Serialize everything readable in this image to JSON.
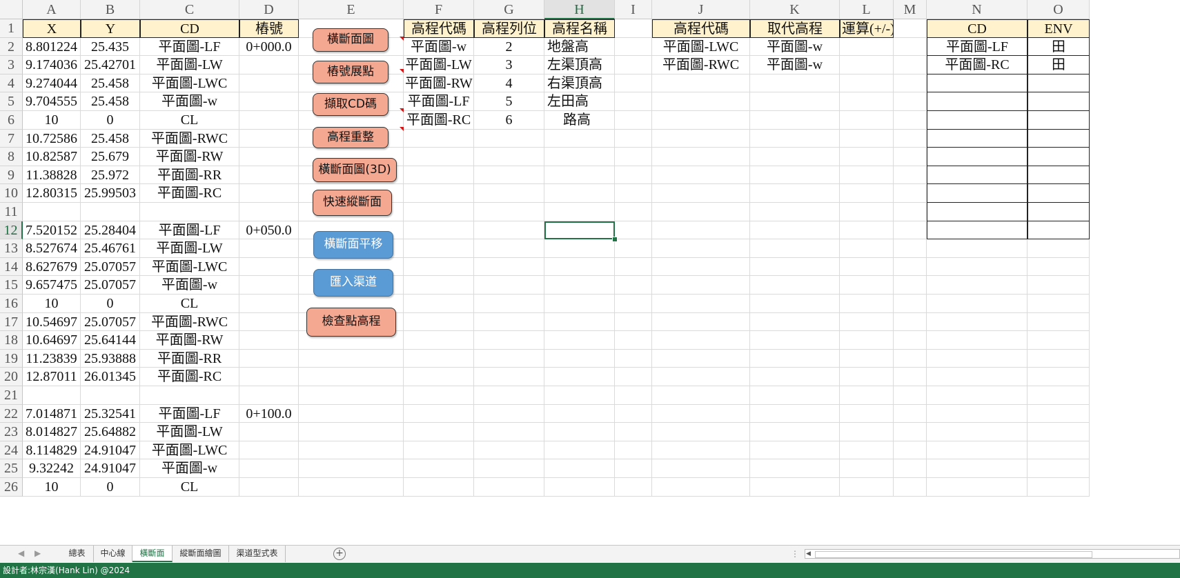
{
  "columns": [
    "A",
    "B",
    "C",
    "D",
    "E",
    "F",
    "G",
    "H",
    "I",
    "J",
    "K",
    "L",
    "M",
    "N",
    "O"
  ],
  "active_column": "H",
  "active_row": 12,
  "rows": [
    {
      "num": 1,
      "A": "X",
      "B": "Y",
      "C": "CD",
      "D": "樁號",
      "F": "高程代碼",
      "G": "高程列位",
      "H": "高程名稱",
      "J": "高程代碼",
      "K": "取代高程",
      "L": "運算(+/-)",
      "N": "CD",
      "O": "ENV"
    },
    {
      "num": 2,
      "A": "8.801224",
      "B": "25.435",
      "C": "平面圖-LF",
      "D": "0+000.0",
      "F": "平面圖-w",
      "G": "2",
      "H": "地盤高",
      "J": "平面圖-LWC",
      "K": "平面圖-w",
      "N": "平面圖-LF",
      "O": "田"
    },
    {
      "num": 3,
      "A": "9.174036",
      "B": "25.42701",
      "C": "平面圖-LW",
      "F": "平面圖-LW",
      "G": "3",
      "H": "左渠頂高",
      "J": "平面圖-RWC",
      "K": "平面圖-w",
      "N": "平面圖-RC",
      "O": "田"
    },
    {
      "num": 4,
      "A": "9.274044",
      "B": "25.458",
      "C": "平面圖-LWC",
      "F": "平面圖-RW",
      "G": "4",
      "H": "右渠頂高"
    },
    {
      "num": 5,
      "A": "9.704555",
      "B": "25.458",
      "C": "平面圖-w",
      "F": "平面圖-LF",
      "G": "5",
      "H": "左田高"
    },
    {
      "num": 6,
      "A": "10",
      "B": "0",
      "C": "CL",
      "F": "平面圖-RC",
      "G": "6",
      "H": "路高"
    },
    {
      "num": 7,
      "A": "10.72586",
      "B": "25.458",
      "C": "平面圖-RWC"
    },
    {
      "num": 8,
      "A": "10.82587",
      "B": "25.679",
      "C": "平面圖-RW"
    },
    {
      "num": 9,
      "A": "11.38828",
      "B": "25.972",
      "C": "平面圖-RR"
    },
    {
      "num": 10,
      "A": "12.80315",
      "B": "25.99503",
      "C": "平面圖-RC"
    },
    {
      "num": 11
    },
    {
      "num": 12,
      "A": "7.520152",
      "B": "25.28404",
      "C": "平面圖-LF",
      "D": "0+050.0"
    },
    {
      "num": 13,
      "A": "8.527674",
      "B": "25.46761",
      "C": "平面圖-LW"
    },
    {
      "num": 14,
      "A": "8.627679",
      "B": "25.07057",
      "C": "平面圖-LWC"
    },
    {
      "num": 15,
      "A": "9.657475",
      "B": "25.07057",
      "C": "平面圖-w"
    },
    {
      "num": 16,
      "A": "10",
      "B": "0",
      "C": "CL"
    },
    {
      "num": 17,
      "A": "10.54697",
      "B": "25.07057",
      "C": "平面圖-RWC"
    },
    {
      "num": 18,
      "A": "10.64697",
      "B": "25.64144",
      "C": "平面圖-RW"
    },
    {
      "num": 19,
      "A": "11.23839",
      "B": "25.93888",
      "C": "平面圖-RR"
    },
    {
      "num": 20,
      "A": "12.87011",
      "B": "26.01345",
      "C": "平面圖-RC"
    },
    {
      "num": 21
    },
    {
      "num": 22,
      "A": "7.014871",
      "B": "25.32541",
      "C": "平面圖-LF",
      "D": "0+100.0"
    },
    {
      "num": 23,
      "A": "8.014827",
      "B": "25.64882",
      "C": "平面圖-LW"
    },
    {
      "num": 24,
      "A": "8.114829",
      "B": "24.91047",
      "C": "平面圖-LWC"
    },
    {
      "num": 25,
      "A": "9.32242",
      "B": "24.91047",
      "C": "平面圖-w"
    },
    {
      "num": 26,
      "A": "10",
      "B": "0",
      "C": "CL"
    }
  ],
  "buttons": [
    {
      "id": "cross-section",
      "label": "橫斷面圖",
      "style": "orange"
    },
    {
      "id": "station-points",
      "label": "樁號展點",
      "style": "orange"
    },
    {
      "id": "extract-cd",
      "label": "擷取CD碼",
      "style": "orange"
    },
    {
      "id": "elevation-adjust",
      "label": "高程重整",
      "style": "orange"
    },
    {
      "id": "cross-section-3d",
      "label": "橫斷面圖(3D)",
      "style": "orange"
    },
    {
      "id": "quick-profile",
      "label": "快速縱斷面",
      "style": "orange"
    },
    {
      "id": "cross-section-shift",
      "label": "橫斷面平移",
      "style": "blue"
    },
    {
      "id": "import-channel",
      "label": "匯入渠道",
      "style": "blue"
    },
    {
      "id": "check-elevation",
      "label": "檢查點高程",
      "style": "orange"
    }
  ],
  "sheet_tabs": [
    "總表",
    "中心線",
    "橫斷面",
    "縱斷面繪圖",
    "渠道型式表"
  ],
  "active_tab": "橫斷面",
  "nav": {
    "prev": "◀",
    "next": "▶",
    "add": "+",
    "split": "⋮",
    "scroll_left": "◀"
  },
  "status_text": "設計者:林宗漢(Hank Lin) @2024",
  "colors": {
    "header_fill": "#fff2cc",
    "button_orange": "#f4a891",
    "button_blue": "#5b9bd5",
    "excel_green": "#217346"
  }
}
